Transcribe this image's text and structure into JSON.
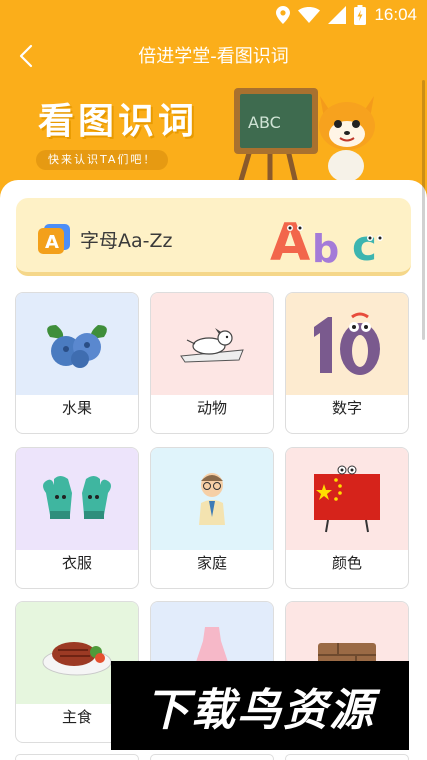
{
  "status_bar": {
    "time": "16:04"
  },
  "title_bar": {
    "title": "倍进学堂-看图识词"
  },
  "hero": {
    "title": "看图识词",
    "subtitle": "快来认识TA们吧！",
    "chalkboard_text": "ABC"
  },
  "alphabet": {
    "badge": "A",
    "label": "字母Aa-Zz",
    "art_letters": [
      "A",
      "b",
      "c"
    ]
  },
  "categories": [
    {
      "label": "水果",
      "icon": "blueberry-icon",
      "bg": "#E2ECFB"
    },
    {
      "label": "动物",
      "icon": "dog-icon",
      "bg": "#FDE6E4"
    },
    {
      "label": "数字",
      "icon": "number-ten-icon",
      "bg": "#FDEBD0"
    },
    {
      "label": "衣服",
      "icon": "mittens-icon",
      "bg": "#EDE4FB"
    },
    {
      "label": "家庭",
      "icon": "grandpa-icon",
      "bg": "#E0F4FB"
    },
    {
      "label": "颜色",
      "icon": "china-flag-icon",
      "bg": "#FDE6E4"
    },
    {
      "label": "主食",
      "icon": "steak-icon",
      "bg": "#E6F6DE"
    },
    {
      "label": "",
      "icon": "dress-icon",
      "bg": "#E2ECFB"
    },
    {
      "label": "",
      "icon": "wood-icon",
      "bg": "#FDE6E4"
    }
  ],
  "watermark": {
    "text": "下载鸟资源"
  },
  "colors": {
    "brand": "#FBAE1A",
    "banner": "#FEF1C6"
  }
}
